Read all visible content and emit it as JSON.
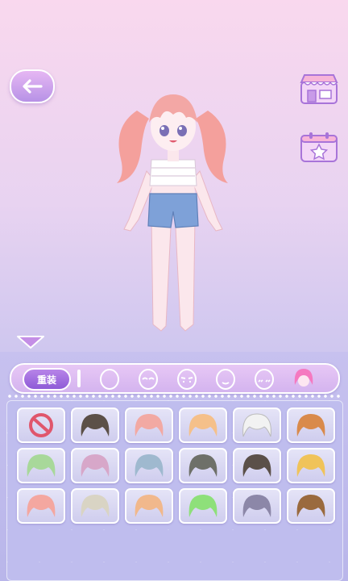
{
  "top_bar": {
    "back_icon": "arrow-left-icon",
    "shop_icon": "shop-icon",
    "gallery_icon": "star-calendar-icon"
  },
  "panel": {
    "reset_label": "重装",
    "tabs": [
      {
        "name": "face-shape",
        "icon": "face-outline-icon"
      },
      {
        "name": "eyes",
        "icon": "eyes-icon"
      },
      {
        "name": "eyebrows",
        "icon": "eyebrows-icon"
      },
      {
        "name": "mouth",
        "icon": "mouth-icon"
      },
      {
        "name": "blush",
        "icon": "blush-icon"
      },
      {
        "name": "hair",
        "icon": "hair-icon",
        "selected": true
      }
    ],
    "items": [
      {
        "icon": "none-icon",
        "color": "#e0566c"
      },
      {
        "icon": "hair-icon",
        "color": "#5c5048"
      },
      {
        "icon": "hair-icon",
        "color": "#f2a9a3"
      },
      {
        "icon": "hair-icon",
        "color": "#f5c08a"
      },
      {
        "icon": "hair-icon",
        "color": "#f2f2f2"
      },
      {
        "icon": "hair-icon",
        "color": "#d98a4b"
      },
      {
        "icon": "hair-icon",
        "color": "#a8d89a"
      },
      {
        "icon": "hair-icon",
        "color": "#d7a7c9"
      },
      {
        "icon": "hair-icon",
        "color": "#9fb9cf"
      },
      {
        "icon": "hair-icon",
        "color": "#6e7069"
      },
      {
        "icon": "hair-icon",
        "color": "#5b5049"
      },
      {
        "icon": "hair-icon",
        "color": "#f0c35a"
      },
      {
        "icon": "hair-icon",
        "color": "#f4a7a0"
      },
      {
        "icon": "hair-icon",
        "color": "#d9d4c4"
      },
      {
        "icon": "hair-icon",
        "color": "#f1b88c"
      },
      {
        "icon": "hair-icon",
        "color": "#8ee07a"
      },
      {
        "icon": "hair-icon",
        "color": "#8c87a8"
      },
      {
        "icon": "hair-icon",
        "color": "#9a6a3e"
      }
    ]
  }
}
